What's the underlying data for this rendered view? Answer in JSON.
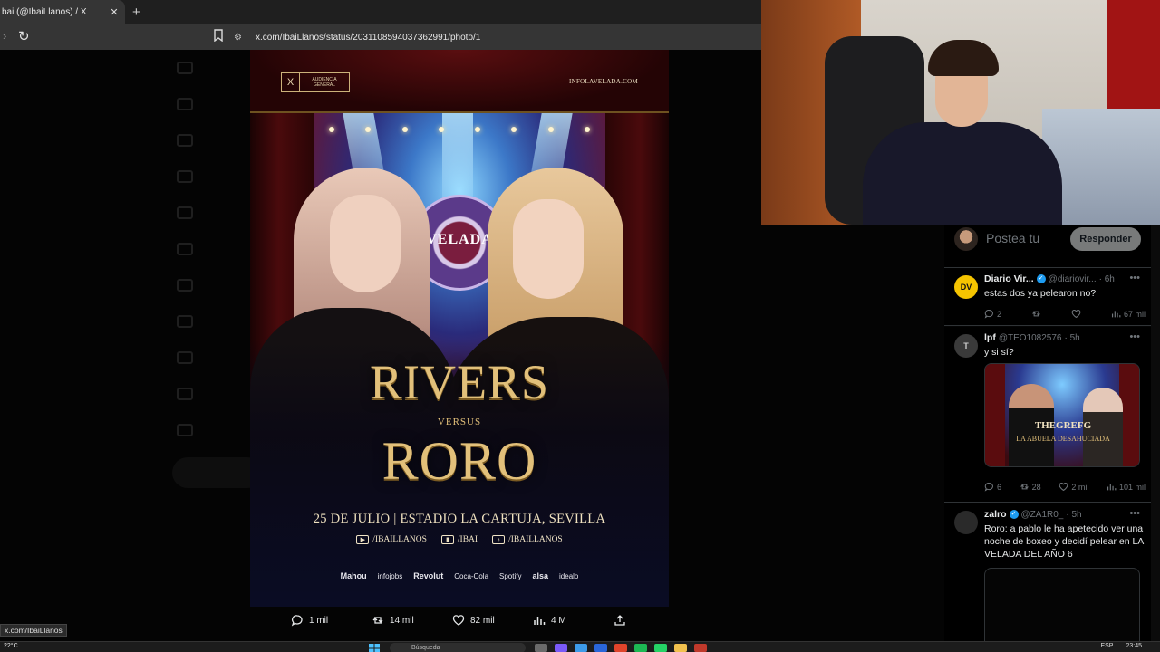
{
  "browser": {
    "tab_title": "bai (@IbaiLlanos) / X",
    "tab_close": "✕",
    "new_tab": "+",
    "url": "x.com/IbaiLlanos/status/2031108594037362991/photo/1",
    "status_url": "x.com/IbaiLlanos"
  },
  "poster": {
    "badge_top": "AUDIENCIA",
    "badge_bottom": "GENERAL",
    "site": "INFOLAVELADA.COM",
    "emblem": "VELADA",
    "fighter1": "RIVERS",
    "versus": "VERSUS",
    "fighter2": "RORO",
    "date_venue": "25 DE JULIO | ESTADIO LA CARTUJA, SEVILLA",
    "socials": [
      {
        "icon": "youtube-icon",
        "glyph": "▶",
        "label": "/IBAILLANOS"
      },
      {
        "icon": "twitch-icon",
        "glyph": "▮",
        "label": "/IBAI"
      },
      {
        "icon": "tiktok-icon",
        "glyph": "♪",
        "label": "/IBAILLANOS"
      }
    ],
    "sponsors": [
      "Mahou",
      "Revolut",
      "alsa",
      "idealo",
      "Spotify",
      "infojobs",
      "Coca-Cola"
    ]
  },
  "stats": {
    "replies": "1 mil",
    "reposts": "14 mil",
    "likes": "82 mil",
    "views": "4 M"
  },
  "reply": {
    "placeholder": "Postea tu",
    "button": "Responder"
  },
  "tweets": [
    {
      "initials": "DV",
      "avatar_color": "#f5c400",
      "name": "Diario Vir...",
      "handle": "@diariovir...",
      "time": "· 6h",
      "text": "estas dos ya pelearon no?",
      "replies": "2",
      "reposts": "",
      "likes": "",
      "views": "67 mil"
    },
    {
      "initials": "T",
      "avatar_color": "#3a3a3a",
      "name": "lpf",
      "handle": "@TEO1082576",
      "time": "· 5h",
      "text": "y si sí?",
      "image_title": "THEGREFG",
      "image_subtitle": "LA ABUELA DESAHUCIADA",
      "replies": "6",
      "reposts": "28",
      "likes": "2 mil",
      "views": "101 mil"
    },
    {
      "initials": "",
      "avatar_color": "#2a2a2a",
      "name": "zalro",
      "handle": "@ZA1R0_",
      "time": "· 5h",
      "text": "Roro: a pablo le ha apetecido ver una noche de boxeo y decidí pelear en LA VELADA DEL AÑO 6"
    }
  ],
  "taskbar": {
    "weather": "22°C",
    "search": "Búsqueda",
    "lang": "ESP",
    "time": "23:45"
  },
  "colors": {
    "accent": "#1d9bf0",
    "gold": "#e2c07a",
    "background": "#000000"
  }
}
